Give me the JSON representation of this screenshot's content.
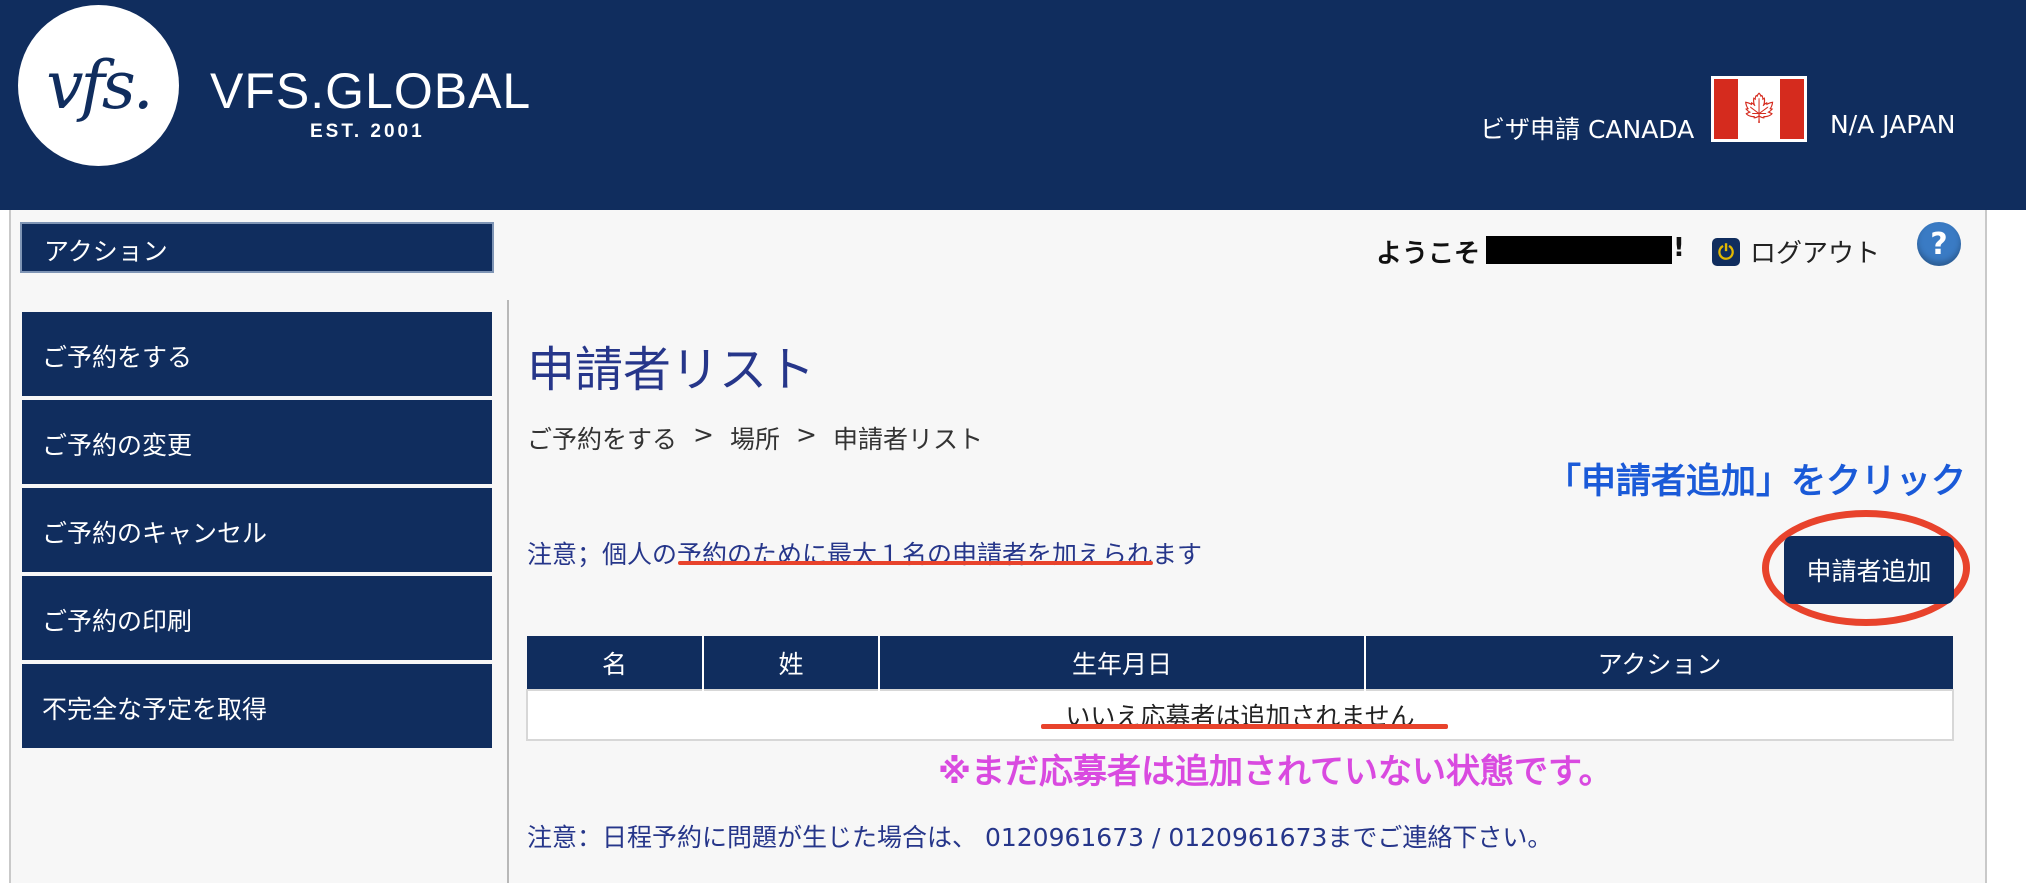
{
  "header": {
    "logo_text": "vfs.",
    "brand_name": "VFS.GLOBAL",
    "brand_est": "EST. 2001",
    "visa_label": "ビザ申請 CANADA",
    "country_label": "N/A JAPAN",
    "flag_icon": "canada-flag-icon"
  },
  "sidebar": {
    "header": "アクション",
    "items": [
      {
        "label": "ご予約をする"
      },
      {
        "label": "ご予約の変更"
      },
      {
        "label": "ご予約のキャンセル"
      },
      {
        "label": "ご予約の印刷"
      },
      {
        "label": "不完全な予定を取得"
      }
    ]
  },
  "topbar": {
    "welcome": "ようこそ",
    "welcome_suffix": "!",
    "logout": "ログアウト",
    "help": "?"
  },
  "main": {
    "title": "申請者リスト",
    "breadcrumb": [
      "ご予約をする",
      "場所",
      "申請者リスト"
    ],
    "breadcrumb_sep": ">",
    "notice_max": "注意；個人の予約のために最大１名の申請者を加えられます",
    "add_button": "申請者追加",
    "table": {
      "headers": [
        "名",
        "姓",
        "生年月日",
        "アクション"
      ],
      "empty_message": "いいえ応募者は追加されません"
    },
    "contact_note": "注意：日程予約に問題が生じた場合は、 0120961673 / 0120961673までご連絡下さい。"
  },
  "annotations": {
    "click_hint": "「申請者追加」をクリック",
    "empty_hint": "※まだ応募者は追加されていない状態です。"
  },
  "colors": {
    "navy": "#102d5e",
    "title_blue": "#26368a",
    "annotation_red": "#e8432c",
    "annotation_blue": "#1a5ad8",
    "annotation_pink": "#d94ae0"
  }
}
